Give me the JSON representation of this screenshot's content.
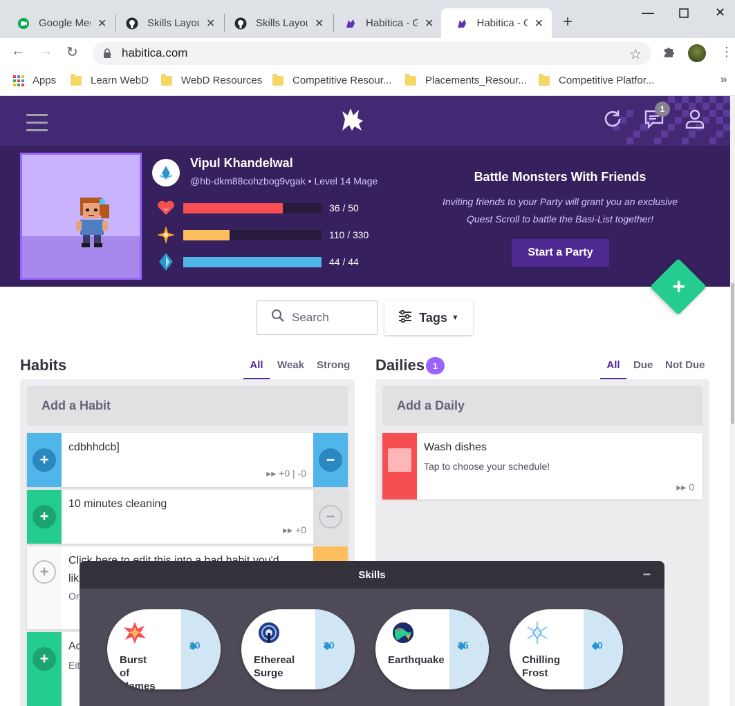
{
  "browser": {
    "tabs": [
      {
        "label": "Google Meet",
        "icon": "google-meet-icon"
      },
      {
        "label": "Skills Layout",
        "icon": "github-icon"
      },
      {
        "label": "Skills Layout",
        "icon": "github-icon"
      },
      {
        "label": "Habitica - Gamify Your Life",
        "icon": "habitica-icon"
      },
      {
        "label": "Habitica - Gamify Your Life",
        "icon": "habitica-icon",
        "active": true
      }
    ],
    "url": "habitica.com",
    "bookmarks": [
      "Apps",
      "Learn WebD",
      "WebD Resources",
      "Competitive Resour...",
      "Placements_Resour...",
      "Competitive Platfor..."
    ],
    "more_bookmarks": "»"
  },
  "header": {
    "notification_count": "1"
  },
  "user": {
    "name": "Vipul Khandelwal",
    "handle": "@hb-dkm88cohzbog9vgak",
    "level": "Level 14 Mage",
    "separator": "•",
    "stats": [
      {
        "name": "health",
        "value": "36 / 50",
        "fraction": 0.72,
        "color": "#f74e52"
      },
      {
        "name": "experience",
        "value": "110 / 330",
        "fraction": 0.333,
        "color": "#ffbe5d"
      },
      {
        "name": "mana",
        "value": "44 / 44",
        "fraction": 1.0,
        "color": "#50b5e9"
      }
    ]
  },
  "party": {
    "title": "Battle Monsters With Friends",
    "text_line1": "Inviting friends to your Party will grant you an exclusive",
    "text_line2": "Quest Scroll to battle the Basi-List together!",
    "button": "Start a Party"
  },
  "filters": {
    "search_placeholder": "Search",
    "tags_label": "Tags"
  },
  "habits": {
    "title": "Habits",
    "tabs": [
      "All",
      "Weak",
      "Strong"
    ],
    "add_label": "Add a Habit",
    "items": [
      {
        "text": "cdbhhdcb]",
        "meta": "▸▸ +0 | -0"
      },
      {
        "text": "10 minutes cleaning",
        "meta": "▸▸ +0"
      },
      {
        "text": "Click here to edit this into a bad habit you'd",
        "text2": "lik",
        "sub": "Or"
      },
      {
        "text": "Ac",
        "sub": "Eit"
      }
    ]
  },
  "dailies": {
    "title": "Dailies",
    "badge": "1",
    "tabs": [
      "All",
      "Due",
      "Not Due"
    ],
    "add_label": "Add a Daily",
    "items": [
      {
        "text": "Wash dishes",
        "sub": "Tap to choose your schedule!",
        "meta": "▸▸ 0"
      }
    ]
  },
  "skills": {
    "title": "Skills",
    "minimize": "–",
    "items": [
      {
        "name_lines": [
          "Burst",
          "of",
          "Flames"
        ],
        "cost": "10",
        "icon": "burst-of-flames-icon"
      },
      {
        "name_lines": [
          "Ethereal",
          "Surge"
        ],
        "cost": "30",
        "icon": "ethereal-surge-icon"
      },
      {
        "name_lines": [
          "Earthquake"
        ],
        "cost": "35",
        "icon": "earthquake-icon"
      },
      {
        "name_lines": [
          "Chilling",
          "Frost"
        ],
        "cost": "40",
        "icon": "chilling-frost-icon"
      }
    ]
  }
}
